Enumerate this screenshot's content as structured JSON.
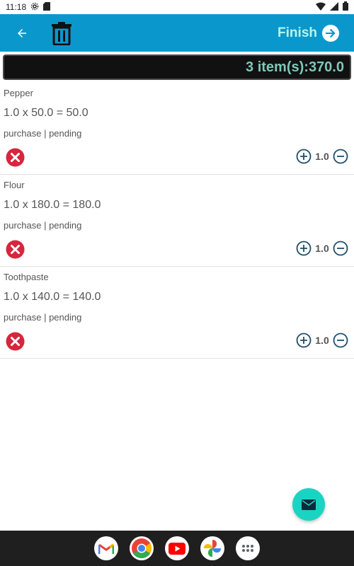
{
  "status_bar": {
    "time": "11:18",
    "icons": [
      "settings-icon",
      "sd-card-icon",
      "wifi-icon",
      "signal-icon",
      "battery-icon"
    ]
  },
  "app_bar": {
    "background": "#0a98cc",
    "back_icon": "arrow-left-icon",
    "delete_icon": "trash-icon",
    "finish_label": "Finish",
    "finish_icon": "arrow-right-circle-icon"
  },
  "summary": {
    "text": "3 item(s):370.0"
  },
  "items": [
    {
      "name": "Pepper",
      "calc": "1.0 x 50.0 = 50.0",
      "status": "purchase | pending",
      "qty": "1.0"
    },
    {
      "name": "Flour",
      "calc": "1.0 x 180.0 = 180.0",
      "status": "purchase | pending",
      "qty": "1.0"
    },
    {
      "name": "Toothpaste",
      "calc": "1.0 x 140.0 = 140.0",
      "status": "purchase | pending",
      "qty": "1.0"
    }
  ],
  "fab": {
    "icon": "mail-icon",
    "color": "#1ad4c3"
  },
  "taskbar": {
    "apps": [
      "gmail-icon",
      "chrome-icon",
      "youtube-icon",
      "photos-icon",
      "app-drawer-icon"
    ]
  }
}
